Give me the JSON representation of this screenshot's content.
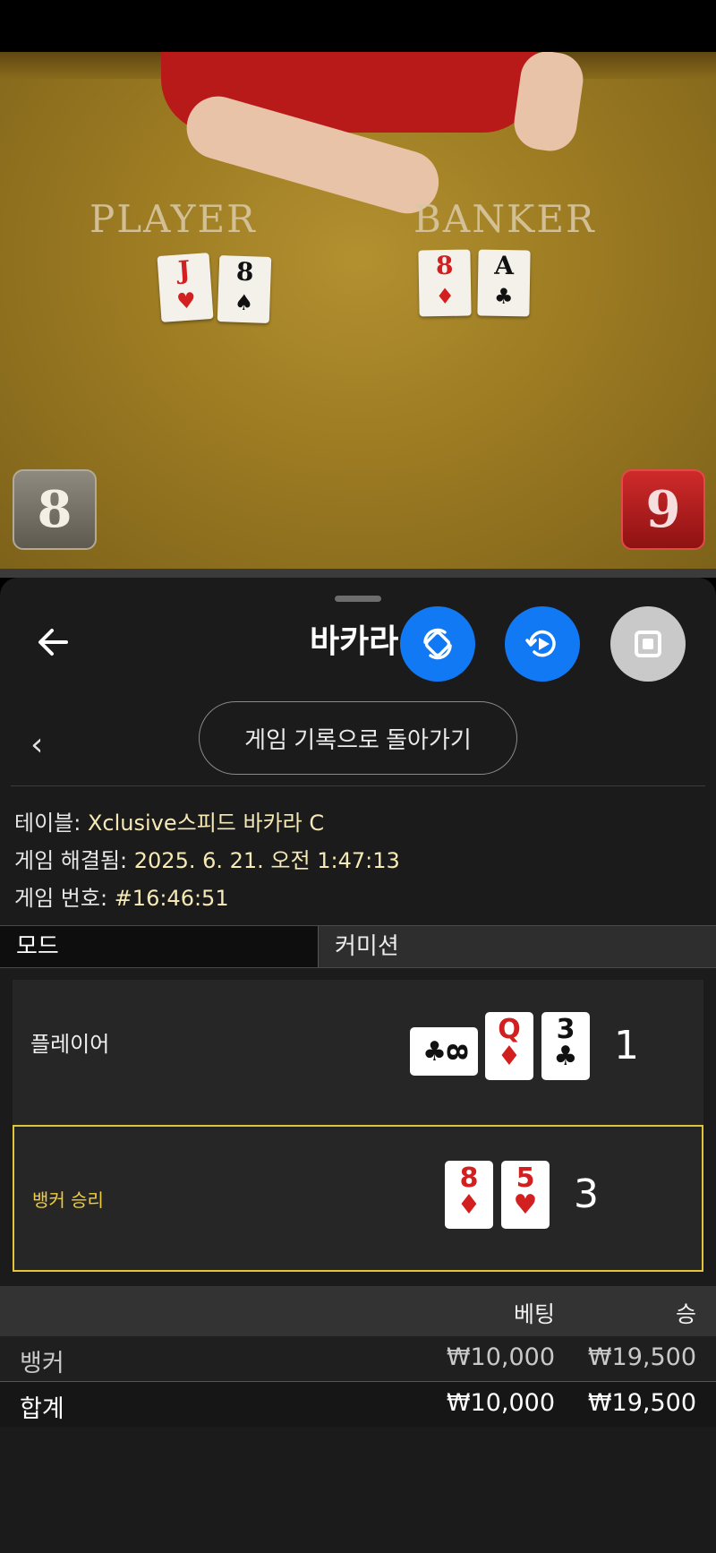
{
  "video": {
    "table_labels": {
      "player": "PLAYER",
      "banker": "BANKER"
    },
    "player_cards": [
      {
        "rank": "J",
        "suit": "♥"
      },
      {
        "rank": "8",
        "suit": "♠"
      }
    ],
    "banker_cards": [
      {
        "rank": "8",
        "suit": "♦"
      },
      {
        "rank": "A",
        "suit": "♣"
      }
    ],
    "player_score": "8",
    "banker_score": "9"
  },
  "header": {
    "title": "바카라",
    "back_icon": "arrow-left-icon",
    "buttons": [
      {
        "icon": "rotate-sync-icon",
        "color": "#1279f4"
      },
      {
        "icon": "replay-play-icon",
        "color": "#1279f4"
      },
      {
        "icon": "stop-square-icon",
        "color": "#c9c9c9"
      }
    ]
  },
  "nav": {
    "chevron": "‹",
    "history_button": "게임 기록으로 돌아가기"
  },
  "info": {
    "table_label": "테이블:",
    "table_value": "Xclusive스피드 바카라 C",
    "resolved_label": "게임 해결됨:",
    "resolved_value": "2025. 6. 21. 오전 1:47:13",
    "number_label": "게임 번호:",
    "number_value": "#16:46:51"
  },
  "mode": {
    "label": "모드",
    "value": "커미션"
  },
  "hands": {
    "player": {
      "name": "플레이어",
      "cards": [
        {
          "rank": "8",
          "suit": "♣",
          "sideways": true
        },
        {
          "rank": "Q",
          "suit": "♦"
        },
        {
          "rank": "3",
          "suit": "♣"
        }
      ],
      "total": "1"
    },
    "banker": {
      "name": "뱅커 승리",
      "cards": [
        {
          "rank": "8",
          "suit": "♦"
        },
        {
          "rank": "5",
          "suit": "♥"
        }
      ],
      "total": "3"
    }
  },
  "bets": {
    "headers": {
      "bet": "베팅",
      "win": "승"
    },
    "rows": [
      {
        "name": "뱅커",
        "bet": "₩10,000",
        "win": "₩19,500"
      },
      {
        "name": "합계",
        "bet": "₩10,000",
        "win": "₩19,500"
      }
    ]
  },
  "colors": {
    "accent_blue": "#1279f4",
    "winner_gold": "#e3c33a",
    "suit_red": "#d21f1f"
  }
}
